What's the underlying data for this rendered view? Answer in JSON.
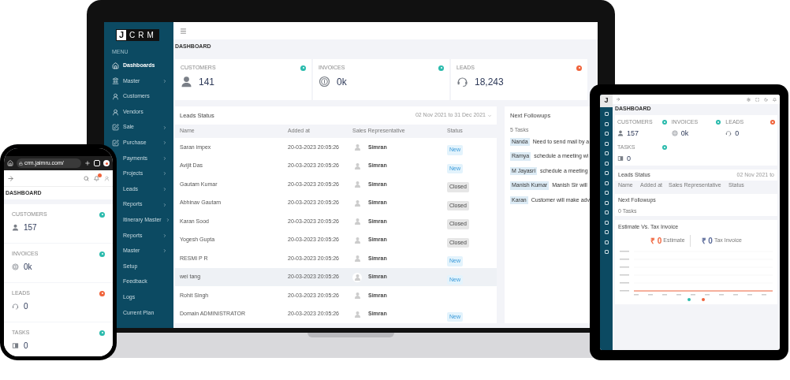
{
  "laptop": {
    "logo_letter": "J",
    "logo_text": "CRM",
    "menu_label": "MENU",
    "sidebar": [
      {
        "label": "Dashboards",
        "has_submenu": false,
        "selected": true
      },
      {
        "label": "Master",
        "has_submenu": true,
        "selected": false
      },
      {
        "label": "Customers",
        "has_submenu": false,
        "selected": false
      },
      {
        "label": "Vendors",
        "has_submenu": false,
        "selected": false
      },
      {
        "label": "Sale",
        "has_submenu": true,
        "selected": false
      },
      {
        "label": "Purchase",
        "has_submenu": true,
        "selected": false
      },
      {
        "label": "Payments",
        "has_submenu": true,
        "selected": false
      },
      {
        "label": "Projects",
        "has_submenu": true,
        "selected": false
      },
      {
        "label": "Leads",
        "has_submenu": true,
        "selected": false
      },
      {
        "label": "Reports",
        "has_submenu": true,
        "selected": false
      },
      {
        "label": "Itinerary Master",
        "has_submenu": true,
        "selected": false
      },
      {
        "label": "Reports",
        "has_submenu": true,
        "selected": false
      },
      {
        "label": "Master",
        "has_submenu": true,
        "selected": false
      },
      {
        "label": "Setup",
        "has_submenu": false,
        "selected": false
      },
      {
        "label": "Feedback",
        "has_submenu": false,
        "selected": false
      },
      {
        "label": "Logs",
        "has_submenu": false,
        "selected": false
      },
      {
        "label": "Current Plan",
        "has_submenu": false,
        "selected": false
      }
    ],
    "page_title": "DASHBOARD",
    "stats": [
      {
        "label": "CUSTOMERS",
        "value": "141",
        "kind": "user",
        "color": "#2bbbad"
      },
      {
        "label": "INVOICES",
        "value": "0k",
        "kind": "coin",
        "color": "#2bbbad"
      },
      {
        "label": "LEADS",
        "value": "18,243",
        "kind": "headset",
        "color": "#f0643c"
      }
    ],
    "leads_status": {
      "title": "Leads Status",
      "date_range": "02 Nov 2021 to 31 Dec 2021",
      "columns": [
        "Name",
        "Added at",
        "Sales Representative",
        "Status"
      ],
      "rows": [
        {
          "name": "Saran impex",
          "added_at": "20-03-2023 20:05:26",
          "rep": "Simran",
          "status": {
            "text": "New",
            "kind": "new"
          },
          "selected": false
        },
        {
          "name": "Avijit Das",
          "added_at": "20-03-2023 20:05:26",
          "rep": "Simran",
          "status": {
            "text": "New",
            "kind": "new"
          },
          "selected": false
        },
        {
          "name": "Gautam Kumar",
          "added_at": "20-03-2023 20:05:26",
          "rep": "Simran",
          "status": {
            "text": "Closed",
            "kind": "closed"
          },
          "selected": false
        },
        {
          "name": "Abhinav Gautam",
          "added_at": "20-03-2023 20:05:26",
          "rep": "Simran",
          "status": {
            "text": "Closed",
            "kind": "closed"
          },
          "selected": false
        },
        {
          "name": "Karan Sood",
          "added_at": "20-03-2023 20:05:26",
          "rep": "Simran",
          "status": {
            "text": "Closed",
            "kind": "closed"
          },
          "selected": false
        },
        {
          "name": "Yogesh Gupta",
          "added_at": "20-03-2023 20:05:26",
          "rep": "Simran",
          "status": {
            "text": "Closed",
            "kind": "closed"
          },
          "selected": false
        },
        {
          "name": "RESMI P R",
          "added_at": "20-03-2023 20:05:26",
          "rep": "Simran",
          "status": {
            "text": "New",
            "kind": "new"
          },
          "selected": false
        },
        {
          "name": "wei tang",
          "added_at": "20-03-2023 20:05:26",
          "rep": "Simran",
          "status": {
            "text": "New",
            "kind": "new"
          },
          "selected": true
        },
        {
          "name": "Rohit Singh",
          "added_at": "20-03-2023 20:05:26",
          "rep": "Simran",
          "selected": false
        },
        {
          "name": "Domain ADMINISTRATOR",
          "added_at": "20-03-2023 20:05:26",
          "rep": "Simran",
          "status": {
            "text": "New",
            "kind": "new"
          },
          "selected": false
        }
      ]
    },
    "followups": {
      "title": "Next Followups",
      "count": "5 Tasks",
      "tasks": [
        {
          "person": "Nanda",
          "note": "Need to send mail by a"
        },
        {
          "person": "Ramya",
          "note": "schedule a meeting wi"
        },
        {
          "person": "M Jayasri",
          "note": "schedule a meeting"
        },
        {
          "person": "Manish Kumar",
          "note": "Manish Sir will"
        },
        {
          "person": "Karan",
          "note": "Customer will make adv"
        }
      ]
    }
  },
  "phone": {
    "url": "crm.jaimru.com/",
    "page_title": "DASHBOARD",
    "stats": [
      {
        "label": "CUSTOMERS",
        "value": "157",
        "kind": "user",
        "color": "#2bbbad"
      },
      {
        "label": "INVOICES",
        "value": "0k",
        "kind": "coin",
        "color": "#2bbbad"
      },
      {
        "label": "LEADS",
        "value": "0",
        "kind": "headset",
        "color": "#f0643c"
      },
      {
        "label": "TASKS",
        "value": "0",
        "kind": "tasks",
        "color": "#2bbbad"
      }
    ]
  },
  "tablet": {
    "logo_letter": "J",
    "page_title": "DASHBOARD",
    "stats": [
      {
        "label": "CUSTOMERS",
        "value": "157",
        "kind": "user",
        "color": "#2bbbad"
      },
      {
        "label": "INVOICES",
        "value": "0k",
        "kind": "coin",
        "color": "#2bbbad"
      },
      {
        "label": "LEADS",
        "value": "0",
        "kind": "headset",
        "color": "#f0643c"
      },
      {
        "label": "TASKS",
        "value": "0",
        "kind": "tasks",
        "color": "#2bbbad"
      }
    ],
    "leads_status": {
      "title": "Leads Status",
      "date_range": "02 Nov 2021 to",
      "columns": [
        "Name",
        "Added at",
        "Sales Representative",
        "Status"
      ]
    },
    "followups": {
      "title": "Next Followups",
      "count": "0 Tasks"
    },
    "chart": {
      "title": "Estimate Vs. Tax Invoice",
      "summary": [
        {
          "value": "₹ 0",
          "label": "Estimate",
          "color": "#f0643c"
        },
        {
          "value": "₹ 0",
          "label": "Tax Invoice",
          "color": "#5b6b9a"
        }
      ]
    }
  }
}
